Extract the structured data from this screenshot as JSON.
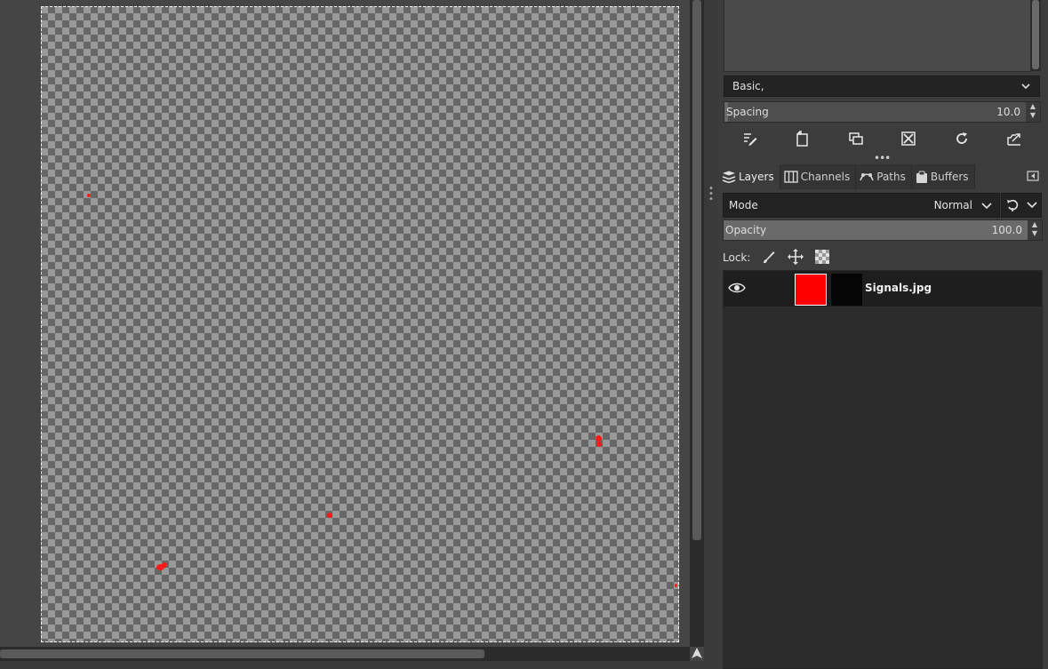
{
  "brushes": {
    "tag_filter": "Basic,",
    "spacing_label": "Spacing",
    "spacing_value": "10.0",
    "spacing_fraction": 0.01,
    "actions": [
      "edit-brush-icon",
      "new-brush-icon",
      "duplicate-brush-icon",
      "delete-brush-icon",
      "refresh-brushes-icon",
      "open-brush-as-image-icon"
    ]
  },
  "tabs": [
    {
      "label": "Layers",
      "icon": "layers-icon",
      "active": true
    },
    {
      "label": "Channels",
      "icon": "channels-icon",
      "active": false
    },
    {
      "label": "Paths",
      "icon": "paths-icon",
      "active": false
    },
    {
      "label": "Buffers",
      "icon": "buffers-icon",
      "active": false
    }
  ],
  "layers_panel": {
    "mode_label": "Mode",
    "mode_value": "Normal",
    "opacity_label": "Opacity",
    "opacity_value": "100.0",
    "opacity_fraction": 1.0,
    "lock_label": "Lock:",
    "lock_icons": [
      "lock-pixels-icon",
      "lock-position-icon",
      "lock-alpha-icon"
    ],
    "layers": [
      {
        "name": "Signals.jpg",
        "visible": true,
        "thumb_color": "#ff0000",
        "selected": true
      }
    ]
  },
  "colors": {
    "accent_red": "#ff0000",
    "panel_bg": "#3c3c3c"
  }
}
